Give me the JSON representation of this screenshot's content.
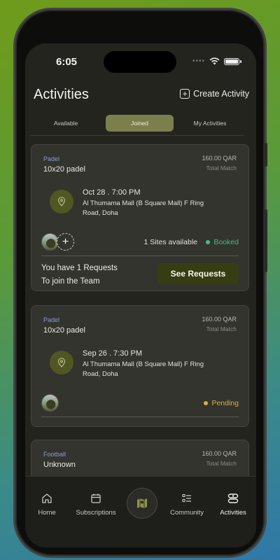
{
  "status_bar": {
    "time": "6:05"
  },
  "header": {
    "title": "Activities",
    "create_label": "Create Activity"
  },
  "tabs": [
    {
      "label": "Available",
      "active": false
    },
    {
      "label": "Joined",
      "active": true
    },
    {
      "label": "My Activities",
      "active": false
    }
  ],
  "cards": [
    {
      "sport": "Padel",
      "title": "10x20 padel",
      "price": "160.00 QAR",
      "price_label": "Total Match",
      "datetime": "Oct 28 . 7:00 PM",
      "address": "Al Thumama Mall (B Square Mall) F Ring Road, Doha",
      "sites": "1 Sites available",
      "status": "Booked",
      "status_color": "#3fbf7f",
      "requests_text_1": "You have 1 Requests",
      "requests_text_2": "To join the Team",
      "requests_button": "See Requests"
    },
    {
      "sport": "Padel",
      "title": "10x20 padel",
      "price": "160.00 QAR",
      "price_label": "Total Match",
      "datetime": "Sep 26 . 7:30 PM",
      "address": "Al Thumama Mall (B Square Mall) F Ring Road, Doha",
      "status": "Pending",
      "status_color": "#d6b13a"
    },
    {
      "sport": "Football",
      "title": "Unknown",
      "price": "160.00 QAR",
      "price_label": "Total Match"
    }
  ],
  "bottom_nav": [
    {
      "label": "Home",
      "icon": "home-icon"
    },
    {
      "label": "Subscriptions",
      "icon": "calendar-icon"
    },
    {
      "label": "",
      "icon": "map-icon"
    },
    {
      "label": "Community",
      "icon": "list-icon"
    },
    {
      "label": "Activities",
      "icon": "activities-icon",
      "active": true
    }
  ],
  "colors": {
    "accent": "#7b7f4c",
    "card_bg": "#34342e",
    "sport_label": "#8a9bd3"
  }
}
